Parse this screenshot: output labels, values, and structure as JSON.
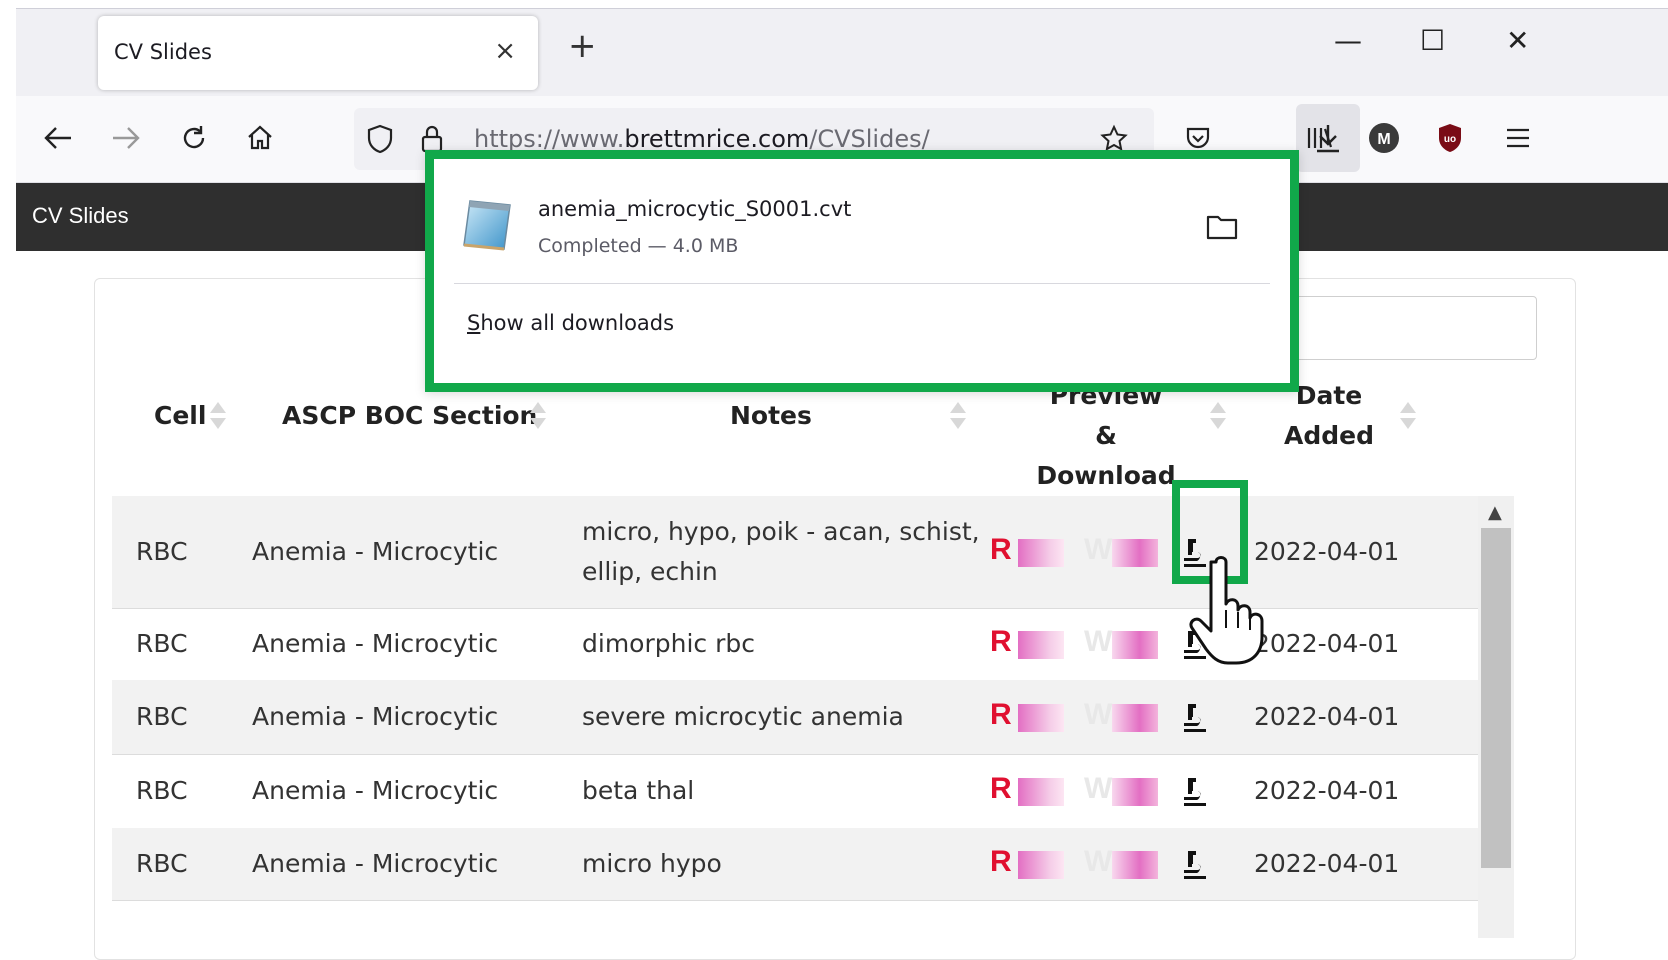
{
  "browser": {
    "tab_title": "CV Slides",
    "tab_close": "×",
    "new_tab": "+",
    "url_prefix": "https://www.",
    "url_domain": "brettmrice.com",
    "url_path": "/CVSlides/",
    "window_controls": [
      "—",
      "☐",
      "✕"
    ]
  },
  "site": {
    "brand": "CV Slides"
  },
  "download_panel": {
    "file_name": "anemia_microcytic_S0001.cvt",
    "status": "Completed — 4.0 MB",
    "show_all_first": "S",
    "show_all_rest": "how all downloads"
  },
  "table": {
    "headers": {
      "cell": "Cell",
      "section": "ASCP BOC Section",
      "notes": "Notes",
      "preview_line1": "Preview &",
      "preview_line2": "Download",
      "date_line1": "Date",
      "date_line2": "Added"
    },
    "rows": [
      {
        "cell": "RBC",
        "section": "Anemia - Microcytic",
        "notes_line1": "micro, hypo, poik - acan, schist,",
        "notes_line2": "ellip, echin",
        "preview_r": "R",
        "preview_w": "W",
        "date": "2022-04-01"
      },
      {
        "cell": "RBC",
        "section": "Anemia - Microcytic",
        "notes_line1": "dimorphic rbc",
        "notes_line2": "",
        "preview_r": "R",
        "preview_w": "W",
        "date": "2022-04-01"
      },
      {
        "cell": "RBC",
        "section": "Anemia - Microcytic",
        "notes_line1": "severe microcytic anemia",
        "notes_line2": "",
        "preview_r": "R",
        "preview_w": "W",
        "date": "2022-04-01"
      },
      {
        "cell": "RBC",
        "section": "Anemia - Microcytic",
        "notes_line1": "beta thal",
        "notes_line2": "",
        "preview_r": "R",
        "preview_w": "W",
        "date": "2022-04-01"
      },
      {
        "cell": "RBC",
        "section": "Anemia - Microcytic",
        "notes_line1": "micro hypo",
        "notes_line2": "",
        "preview_r": "R",
        "preview_w": "W",
        "date": "2022-04-01"
      }
    ]
  },
  "colors": {
    "highlight": "#11a84a",
    "preview_r": "#e01030",
    "header_bar": "#2f2f2f"
  }
}
